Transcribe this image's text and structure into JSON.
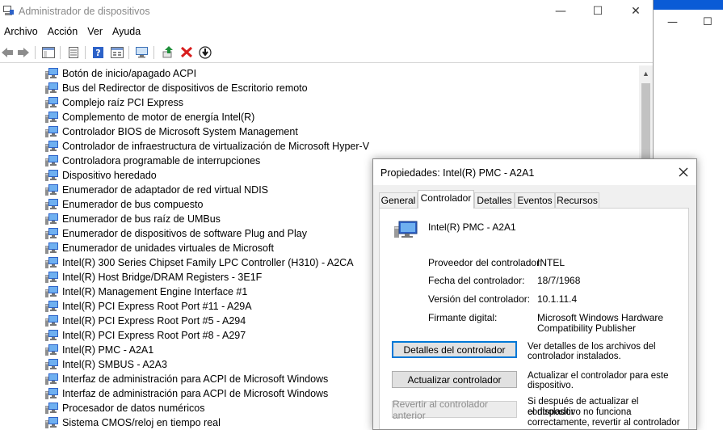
{
  "window": {
    "title": "Administrador de dispositivos"
  },
  "menu": [
    "Archivo",
    "Acción",
    "Ver",
    "Ayuda"
  ],
  "toolbar": {
    "buttons": [
      "back-arrow-icon",
      "forward-arrow-icon",
      "show-hide-console-tree-icon",
      "properties-icon",
      "help-icon",
      "view-icon",
      "scan-hardware-icon",
      "update-driver-icon",
      "uninstall-icon",
      "disable-device-icon"
    ],
    "colors": {
      "green": "#1e8f3a",
      "red": "#d81e1e",
      "blue": "#2d62c8"
    }
  },
  "devices": [
    "Botón de inicio/apagado ACPI",
    "Bus del Redirector de dispositivos de Escritorio remoto",
    "Complejo raíz PCI Express",
    "Complemento de motor de energía Intel(R)",
    "Controlador BIOS de Microsoft System Management",
    "Controlador de infraestructura de virtualización de Microsoft Hyper-V",
    "Controladora programable de interrupciones",
    "Dispositivo heredado",
    "Enumerador de adaptador de red virtual NDIS",
    "Enumerador de bus compuesto",
    "Enumerador de bus raíz de UMBus",
    "Enumerador de dispositivos de software Plug and Play",
    "Enumerador de unidades virtuales de Microsoft",
    "Intel(R) 300 Series Chipset Family LPC Controller (H310) - A2CA",
    "Intel(R) Host Bridge/DRAM Registers - 3E1F",
    "Intel(R) Management Engine Interface #1",
    "Intel(R) PCI Express Root Port #11 - A29A",
    "Intel(R) PCI Express Root Port #5 - A294",
    "Intel(R) PCI Express Root Port #8 - A297",
    "Intel(R) PMC - A2A1",
    "Intel(R) SMBUS - A2A3",
    "Interfaz de administración para ACPI de Microsoft Windows",
    "Interfaz de administración para ACPI de Microsoft Windows",
    "Procesador de datos numéricos",
    "Sistema CMOS/reloj en tiempo real"
  ],
  "dialog": {
    "title": "Propiedades: Intel(R) PMC - A2A1",
    "tabs": [
      "General",
      "Controlador",
      "Detalles",
      "Eventos",
      "Recursos"
    ],
    "active_tab": "Controlador",
    "device_name": "Intel(R) PMC - A2A1",
    "properties": {
      "provider_label": "Proveedor del controlador:",
      "provider_value": "INTEL",
      "date_label": "Fecha del controlador:",
      "date_value": "18/7/1968",
      "version_label": "Versión del controlador:",
      "version_value": "10.1.11.4",
      "signer_label": "Firmante digital:",
      "signer_line1": "Microsoft Windows Hardware",
      "signer_line2": "Compatibility Publisher"
    },
    "buttons": {
      "details_label": "Detalles del controlador",
      "details_desc1": "Ver detalles de los archivos del",
      "details_desc2": "controlador instalados.",
      "update_label": "Actualizar controlador",
      "update_desc1": "Actualizar el controlador para este",
      "update_desc2": "dispositivo.",
      "rollback_label": "Revertir al controlador anterior",
      "rollback_desc1": "Si después de actualizar el controlador",
      "rollback_desc2": "el dispositivo no funciona",
      "rollback_desc3": "correctamente, revertir al controlador"
    }
  }
}
